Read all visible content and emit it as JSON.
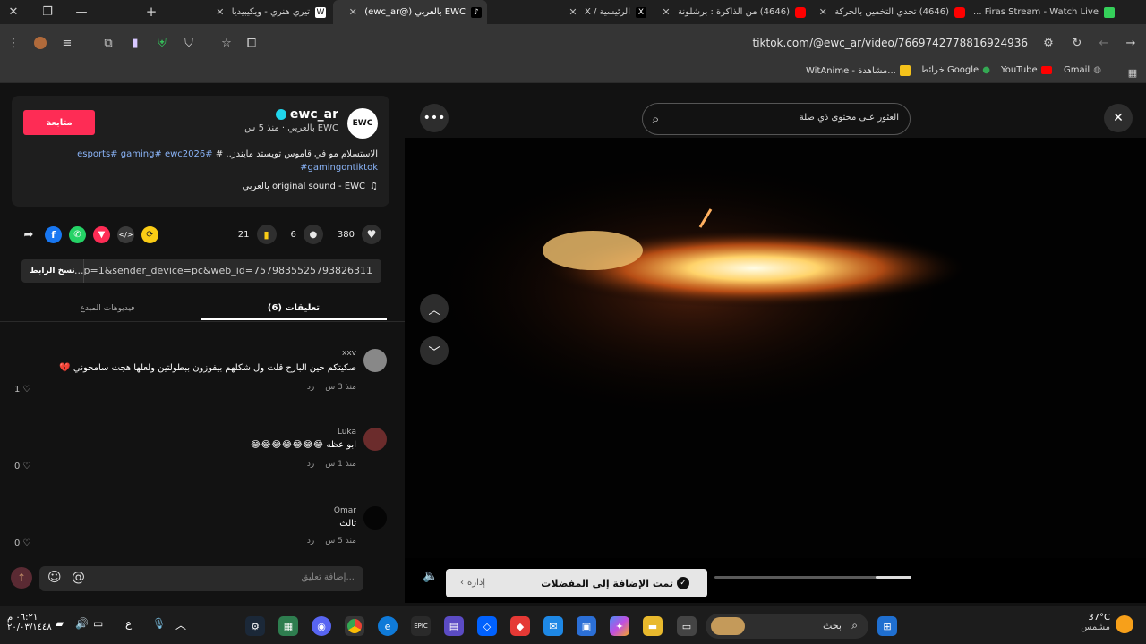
{
  "tabs": [
    {
      "title": "Firas Stream - Watch Live ...",
      "favicon_color": "#35d05a"
    },
    {
      "title": "(4646) تحدي التخمين بالحركة",
      "favicon_color": "#ff0000"
    },
    {
      "title": "(4646) من الذاكرة : برشلونة",
      "favicon_color": "#ff0000"
    },
    {
      "title": "الرئيسية / X",
      "favicon_color": "#000000"
    },
    {
      "title": "EWC بالعربي (@ewc_ar)",
      "favicon_color": "#000000"
    },
    {
      "title": "تيري هنري - ويكيبيديا",
      "favicon_color": "#ffffff"
    }
  ],
  "window": {
    "new_tab": "+",
    "minimize": "—",
    "restore": "❐",
    "close": "✕"
  },
  "address_bar": {
    "url": "tiktok.com/@ewc_ar/video/7669742778816924936"
  },
  "bookmarks": [
    {
      "label": "Gmail"
    },
    {
      "label": "YouTube"
    },
    {
      "label": "خرائط Google"
    },
    {
      "label": "WitAnime - مشاهدة..."
    }
  ],
  "post": {
    "username": "ewc_ar",
    "subtitle": "EWC بالعربي · منذ 5 س",
    "follow_label": "متابعة",
    "avatar_text": "EWC",
    "caption_line1": "الاستسلام مو في قاموس تويستد مايندز.. #",
    "caption_tags1": "esports# gaming# ewc2026#",
    "caption_line2": "gamingontiktok#",
    "sound": "original sound - EWC بالعربي",
    "likes": "380",
    "comments": "6",
    "saves": "21",
    "link_text": "...p=1&sender_device=pc&web_id=7579835525793826311",
    "copy_link_label": "نسخ الرابط"
  },
  "tabs_panel": {
    "comments_tab": "(6) تعليقات",
    "creator_videos_tab": "فيديوهات المبدع"
  },
  "comments": [
    {
      "user": "xxv",
      "text": "صكيتكم حين البارح قلت ول شكلهم بيفوزون ببطولتين ولعلها هجت سامحوني 💔",
      "meta": "منذ 3 س",
      "reply": "رد",
      "likes": "1"
    },
    {
      "user": "Luka",
      "text": "ابو عظه 😂😂😂😂😂😂😂",
      "meta": "منذ 1 س",
      "reply": "رد",
      "likes": "0"
    },
    {
      "user": "Omar",
      "text": "ثالث",
      "meta": "منذ 5 س",
      "reply": "رد",
      "likes": "0"
    }
  ],
  "composer": {
    "placeholder": "إضافة تعليق..."
  },
  "video": {
    "search_placeholder": "العثور على محتوى ذي صلة",
    "toast_text": "تمت الإضافة إلى المفضلات",
    "toast_action": "إدارة"
  },
  "taskbar": {
    "search_label": "بحث",
    "weather_temp": "37°C",
    "weather_desc": "مشمس",
    "clock_time": "٠٦:٢١ م",
    "clock_date": "٢٠/٠٣/١٤٤٨",
    "lang": "ع"
  },
  "colors": {
    "follow": "#fe2c55",
    "tag": "#8ab4f8",
    "bookmark_yellow": "#facc15"
  }
}
